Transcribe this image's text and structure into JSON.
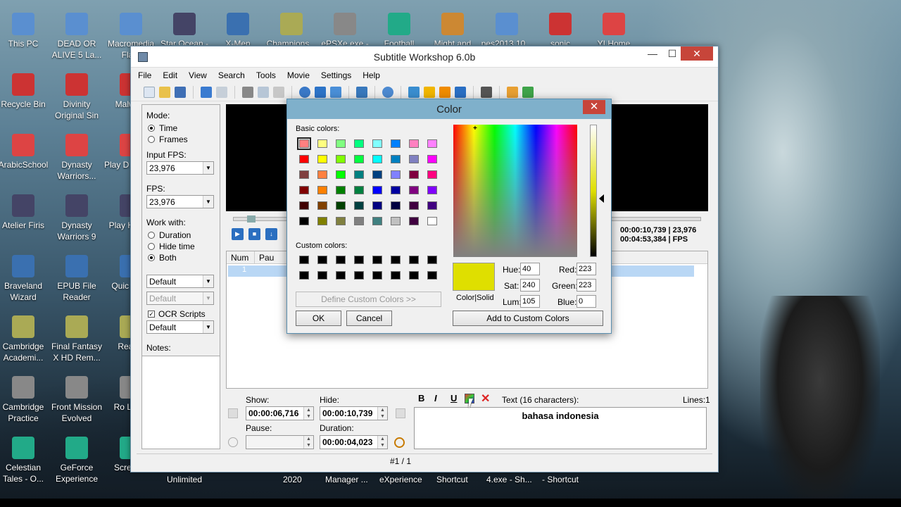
{
  "desktop": {
    "icons_col1": [
      "This PC",
      "Recycle Bin",
      "ArabicSchool",
      "Atelier Firis",
      "Braveland Wizard",
      "Cambridge Academi...",
      "Cambridge Practice",
      "Celestian Tales - O..."
    ],
    "icons_col2": [
      "DEAD OR ALIVE 5 La...",
      "Divinity Original Sin",
      "Dynasty Warriors...",
      "Dynasty Warriors 9",
      "EPUB File Reader",
      "Final Fantasy X HD Rem...",
      "Front Mission Evolved",
      "GeForce Experience"
    ],
    "icons_col3": [
      "Macromedia Fla...",
      "Malwa...",
      "Play D Age I...",
      "Play Hero...",
      "Quic Pla...",
      "Reall...",
      "Ro Lea...",
      "Screen..."
    ],
    "icons_top": [
      "Star Ocean -",
      "X-Men",
      "Champions...",
      "ePSXe.exe -",
      "Football",
      "Might and",
      "pes2013 10...",
      "sonic",
      "YI Home"
    ],
    "taskbar_labels": [
      "Unlimited",
      "2020",
      "Manager ...",
      "eXperience",
      "Shortcut",
      "4.exe - Sh...",
      "- Shortcut"
    ]
  },
  "window": {
    "title": "Subtitle Workshop 6.0b",
    "min_glyph": "—",
    "max_glyph": "☐",
    "close_glyph": "✕",
    "menu": [
      "File",
      "Edit",
      "View",
      "Search",
      "Tools",
      "Movie",
      "Settings",
      "Help"
    ]
  },
  "left": {
    "mode_label": "Mode:",
    "mode_time": "Time",
    "mode_frames": "Frames",
    "input_fps_label": "Input FPS:",
    "input_fps": "23,976",
    "fps_label": "FPS:",
    "fps": "23,976",
    "work_with_label": "Work with:",
    "work_duration": "Duration",
    "work_hide": "Hide time",
    "work_both": "Both",
    "combo1": "Default",
    "combo2": "Default",
    "ocr_label": "OCR Scripts",
    "combo3": "Default",
    "notes_label": "Notes:"
  },
  "player": {
    "time1": "00:00:10,739",
    "time2": "00:04:53,384",
    "fps_value": "23,976",
    "fps_unit": "FPS"
  },
  "grid": {
    "col_num": "Num",
    "col_pause": "Pau",
    "row_num": "1"
  },
  "editor": {
    "show_label": "Show:",
    "show_value": "00:00:06,716",
    "hide_label": "Hide:",
    "hide_value": "00:00:10,739",
    "pause_label": "Pause:",
    "pause_value": "",
    "duration_label": "Duration:",
    "duration_value": "00:00:04,023",
    "bold": "B",
    "italic": "I",
    "underline": "U",
    "text_label": "Text (16 characters):",
    "lines_label": "Lines:1",
    "text": "bahasa indonesia"
  },
  "status": {
    "position": "#1 / 1"
  },
  "color_dialog": {
    "title": "Color",
    "close_glyph": "✕",
    "basic_label": "Basic colors:",
    "custom_label": "Custom colors:",
    "define_button": "Define Custom Colors >>",
    "ok_button": "OK",
    "cancel_button": "Cancel",
    "color_solid_label": "Color|Solid",
    "hue_label": "Hue:",
    "hue": "40",
    "sat_label": "Sat:",
    "sat": "240",
    "lum_label": "Lum:",
    "lum": "105",
    "red_label": "Red:",
    "red": "223",
    "green_label": "Green:",
    "green": "223",
    "blue_label": "Blue:",
    "blue": "0",
    "add_button": "Add to Custom Colors",
    "crosshair": "+",
    "selected_color": "#dfdf00",
    "basic_colors": [
      "#ff8080",
      "#ffff80",
      "#80ff80",
      "#00ff80",
      "#80ffff",
      "#0080ff",
      "#ff80c0",
      "#ff80ff",
      "#ff0000",
      "#ffff00",
      "#80ff00",
      "#00ff40",
      "#00ffff",
      "#0080c0",
      "#8080c0",
      "#ff00ff",
      "#804040",
      "#ff8040",
      "#00ff00",
      "#008080",
      "#004080",
      "#8080ff",
      "#800040",
      "#ff0080",
      "#800000",
      "#ff8000",
      "#008000",
      "#008040",
      "#0000ff",
      "#0000a0",
      "#800080",
      "#8000ff",
      "#400000",
      "#804000",
      "#004000",
      "#004040",
      "#000080",
      "#000040",
      "#400040",
      "#400080",
      "#000000",
      "#808000",
      "#808040",
      "#808080",
      "#408080",
      "#c0c0c0",
      "#400040",
      "#ffffff"
    ]
  }
}
